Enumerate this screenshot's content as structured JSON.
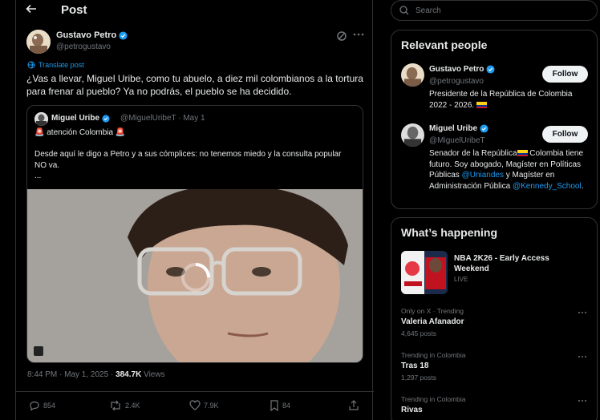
{
  "header": {
    "title": "Post"
  },
  "post": {
    "author_name": "Gustavo Petro",
    "author_handle": "@petrogustavo",
    "translate_label": "Translate post",
    "text": "¿Vas a llevar, Miguel Uribe, como tu abuelo, a diez mil colombianos a la tortura para frenar al pueblo? Ya no podrás, el pueblo se ha decidido.",
    "timestamp": "8:44 PM · May 1, 2025 · ",
    "views_count": "384.7K",
    "views_label": " Views",
    "actions": {
      "replies": "854",
      "reposts": "2.4K",
      "likes": "7.9K",
      "bookmarks": "84"
    }
  },
  "quote": {
    "author_name": "Miguel Uribe",
    "meta": "@MiguelUribeT · May 1",
    "line1_text": " atención Colombia ",
    "line2": "Desde aquí le digo a Petro y a sus cómplices: no tenemos miedo y la consulta popular NO va.",
    "ellipsis": "..."
  },
  "search": {
    "placeholder": "Search"
  },
  "relevant": {
    "title": "Relevant people",
    "people": [
      {
        "name": "Gustavo Petro",
        "handle": "@petrogustavo",
        "bio": "Presidente de la República de Colombia 2022 - 2026. ",
        "follow": "Follow"
      },
      {
        "name": "Miguel Uribe",
        "handle": "@MiguelUribeT",
        "bio_a": "Senador de la República",
        "bio_b": " Colombia tiene futuro. Soy abogado, Magíster en Políticas Públicas ",
        "bio_link1": "@Uniandes",
        "bio_c": " y Magíster en Administración Pública ",
        "bio_link2": "@Kennedy_School",
        "bio_d": ".",
        "follow": "Follow"
      }
    ]
  },
  "happening": {
    "title": "What’s happening",
    "featured": {
      "name": "NBA 2K26 - Early Access Weekend",
      "status": "LIVE"
    },
    "trends": [
      {
        "context": "Only on X · Trending",
        "name": "Valeria Afanador",
        "count": "4,645 posts"
      },
      {
        "context": "Trending in Colombia",
        "name": "Tras 18",
        "count": "1,297 posts"
      },
      {
        "context": "Trending in Colombia",
        "name": "Rivas",
        "count": ""
      }
    ]
  },
  "colors": {
    "background": "#000000",
    "accent": "#1d9bf0",
    "verified": "#1d9bf0",
    "border": "#2f3336",
    "muted": "#71767b"
  }
}
